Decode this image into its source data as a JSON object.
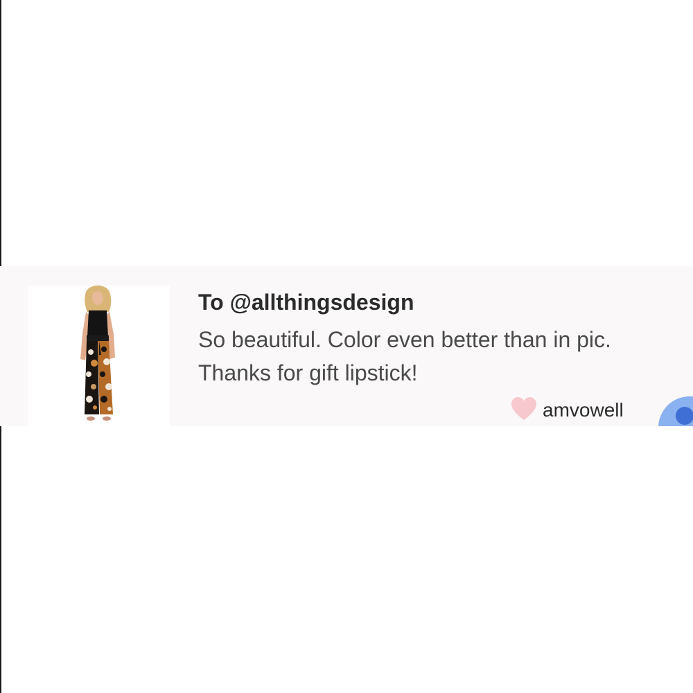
{
  "review": {
    "recipient": "To @allthingsdesign",
    "message_line1": "So beautiful. Color even better than in pic.",
    "message_line2": "Thanks for gift lipstick!",
    "author": "amvowell",
    "product_image": "floral-jumpsuit-photo",
    "heart_icon": "heart-icon",
    "colors": {
      "card_background": "#faf8f8",
      "heart": "#f7c9cf",
      "avatar": "#8ab1f0",
      "avatar_dot": "#3f6ed4"
    }
  }
}
